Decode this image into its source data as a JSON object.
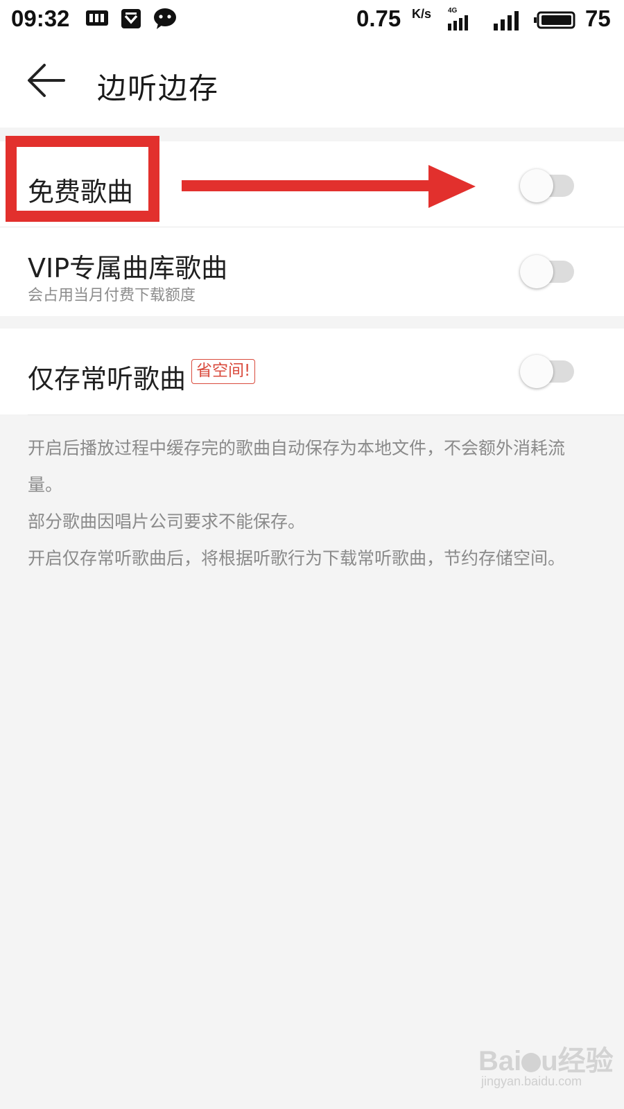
{
  "status_bar": {
    "time": "09:32",
    "speed": "0.75",
    "speed_unit": "K/s",
    "network_label": "4G",
    "battery": "75",
    "icons": [
      "sim-card-icon",
      "shield-check-icon",
      "wechat-icon",
      "signal-4g-icon",
      "signal-icon",
      "battery-icon"
    ]
  },
  "header": {
    "title": "边听边存",
    "back_icon": "arrow-left-icon"
  },
  "settings": [
    {
      "label": "免费歌曲",
      "subtitle": "",
      "enabled": false
    },
    {
      "label": "VIP专属曲库歌曲",
      "subtitle": "会占用当月付费下载额度",
      "enabled": false
    },
    {
      "label": "仅存常听歌曲",
      "badge": "省空间!",
      "enabled": false
    }
  ],
  "description": [
    "开启后播放过程中缓存完的歌曲自动保存为本地文件，不会额外消耗流量。",
    "部分歌曲因唱片公司要求不能保存。",
    "开启仅存常听歌曲后，将根据听歌行为下载常听歌曲，节约存储空间。"
  ],
  "annotation": {
    "color": "#e2302d"
  },
  "watermark": {
    "brand": "Baidu经验",
    "url": "jingyan.baidu.com"
  },
  "colors": {
    "accent_red": "#d94a3c",
    "annotation_red": "#e2302d",
    "toggle_off_track": "#dcdcdc",
    "background": "#f4f4f4"
  }
}
